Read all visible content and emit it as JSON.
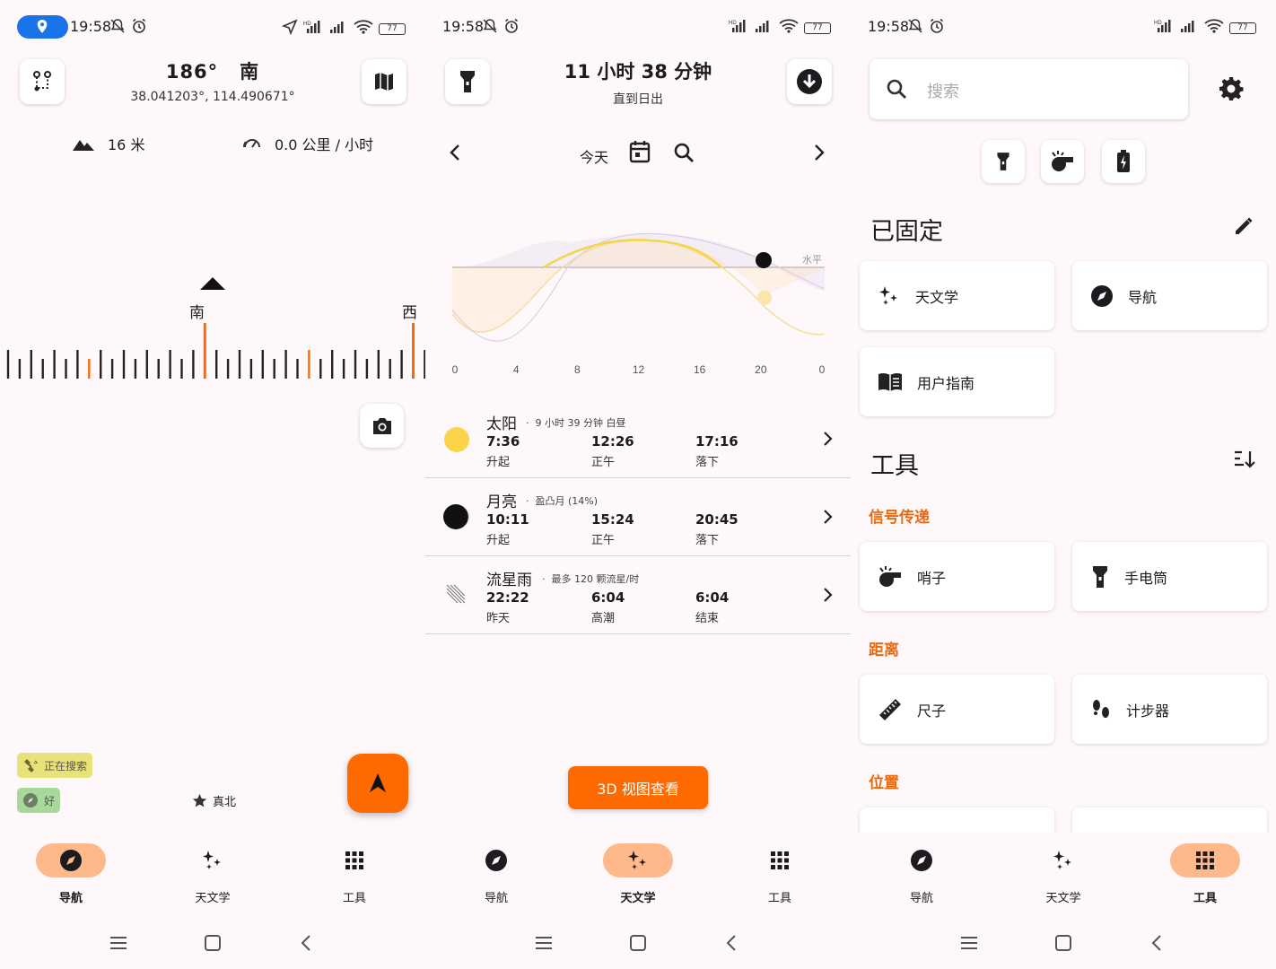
{
  "status": {
    "time": "19:58",
    "battery": "77",
    "hd": "HD"
  },
  "colors": {
    "accent": "#ff6a00",
    "accent_soft": "#ffb88a",
    "subtitle": "#e86a10",
    "location_pill": "#1a73e8"
  },
  "navigation": {
    "bearing": "186°",
    "direction": "南",
    "coordinates": "38.041203°, 114.490671°",
    "altitude": "16 米",
    "speed": "0.0 公里 / 小时",
    "compass_labels": [
      "南",
      "西"
    ],
    "chips": {
      "searching": "正在搜索",
      "good": "好"
    },
    "true_north": "真北"
  },
  "astronomy": {
    "countdown": "11 小时 38 分钟",
    "countdown_sub": "直到日出",
    "today": "今天",
    "chart_horizon": "水平",
    "chart_ticks": [
      "0",
      "4",
      "8",
      "12",
      "16",
      "20",
      "0"
    ],
    "rows": [
      {
        "name": "太阳",
        "meta": "9 小时 39 分钟 白昼",
        "t1": "7:36",
        "l1": "升起",
        "t2": "12:26",
        "l2": "正午",
        "t3": "17:16",
        "l3": "落下"
      },
      {
        "name": "月亮",
        "meta": "盈凸月 (14%)",
        "t1": "10:11",
        "l1": "升起",
        "t2": "15:24",
        "l2": "正午",
        "t3": "20:45",
        "l3": "落下"
      },
      {
        "name": "流星雨",
        "meta": "最多 120 颗流星/时",
        "t1": "22:22",
        "l1": "昨天",
        "t2": "6:04",
        "l2": "高潮",
        "t3": "6:04",
        "l3": "结束"
      }
    ],
    "view3d": "3D 视图查看"
  },
  "tools": {
    "search_placeholder": "搜索",
    "pinned_title": "已固定",
    "pinned": [
      "天文学",
      "导航",
      "用户指南"
    ],
    "tools_title": "工具",
    "groups": [
      {
        "title": "信号传递",
        "items": [
          "哨子",
          "手电筒"
        ]
      },
      {
        "title": "距离",
        "items": [
          "尺子",
          "计步器"
        ]
      },
      {
        "title": "位置",
        "items": []
      }
    ]
  },
  "nav": {
    "navigation": "导航",
    "astronomy": "天文学",
    "tools": "工具"
  }
}
